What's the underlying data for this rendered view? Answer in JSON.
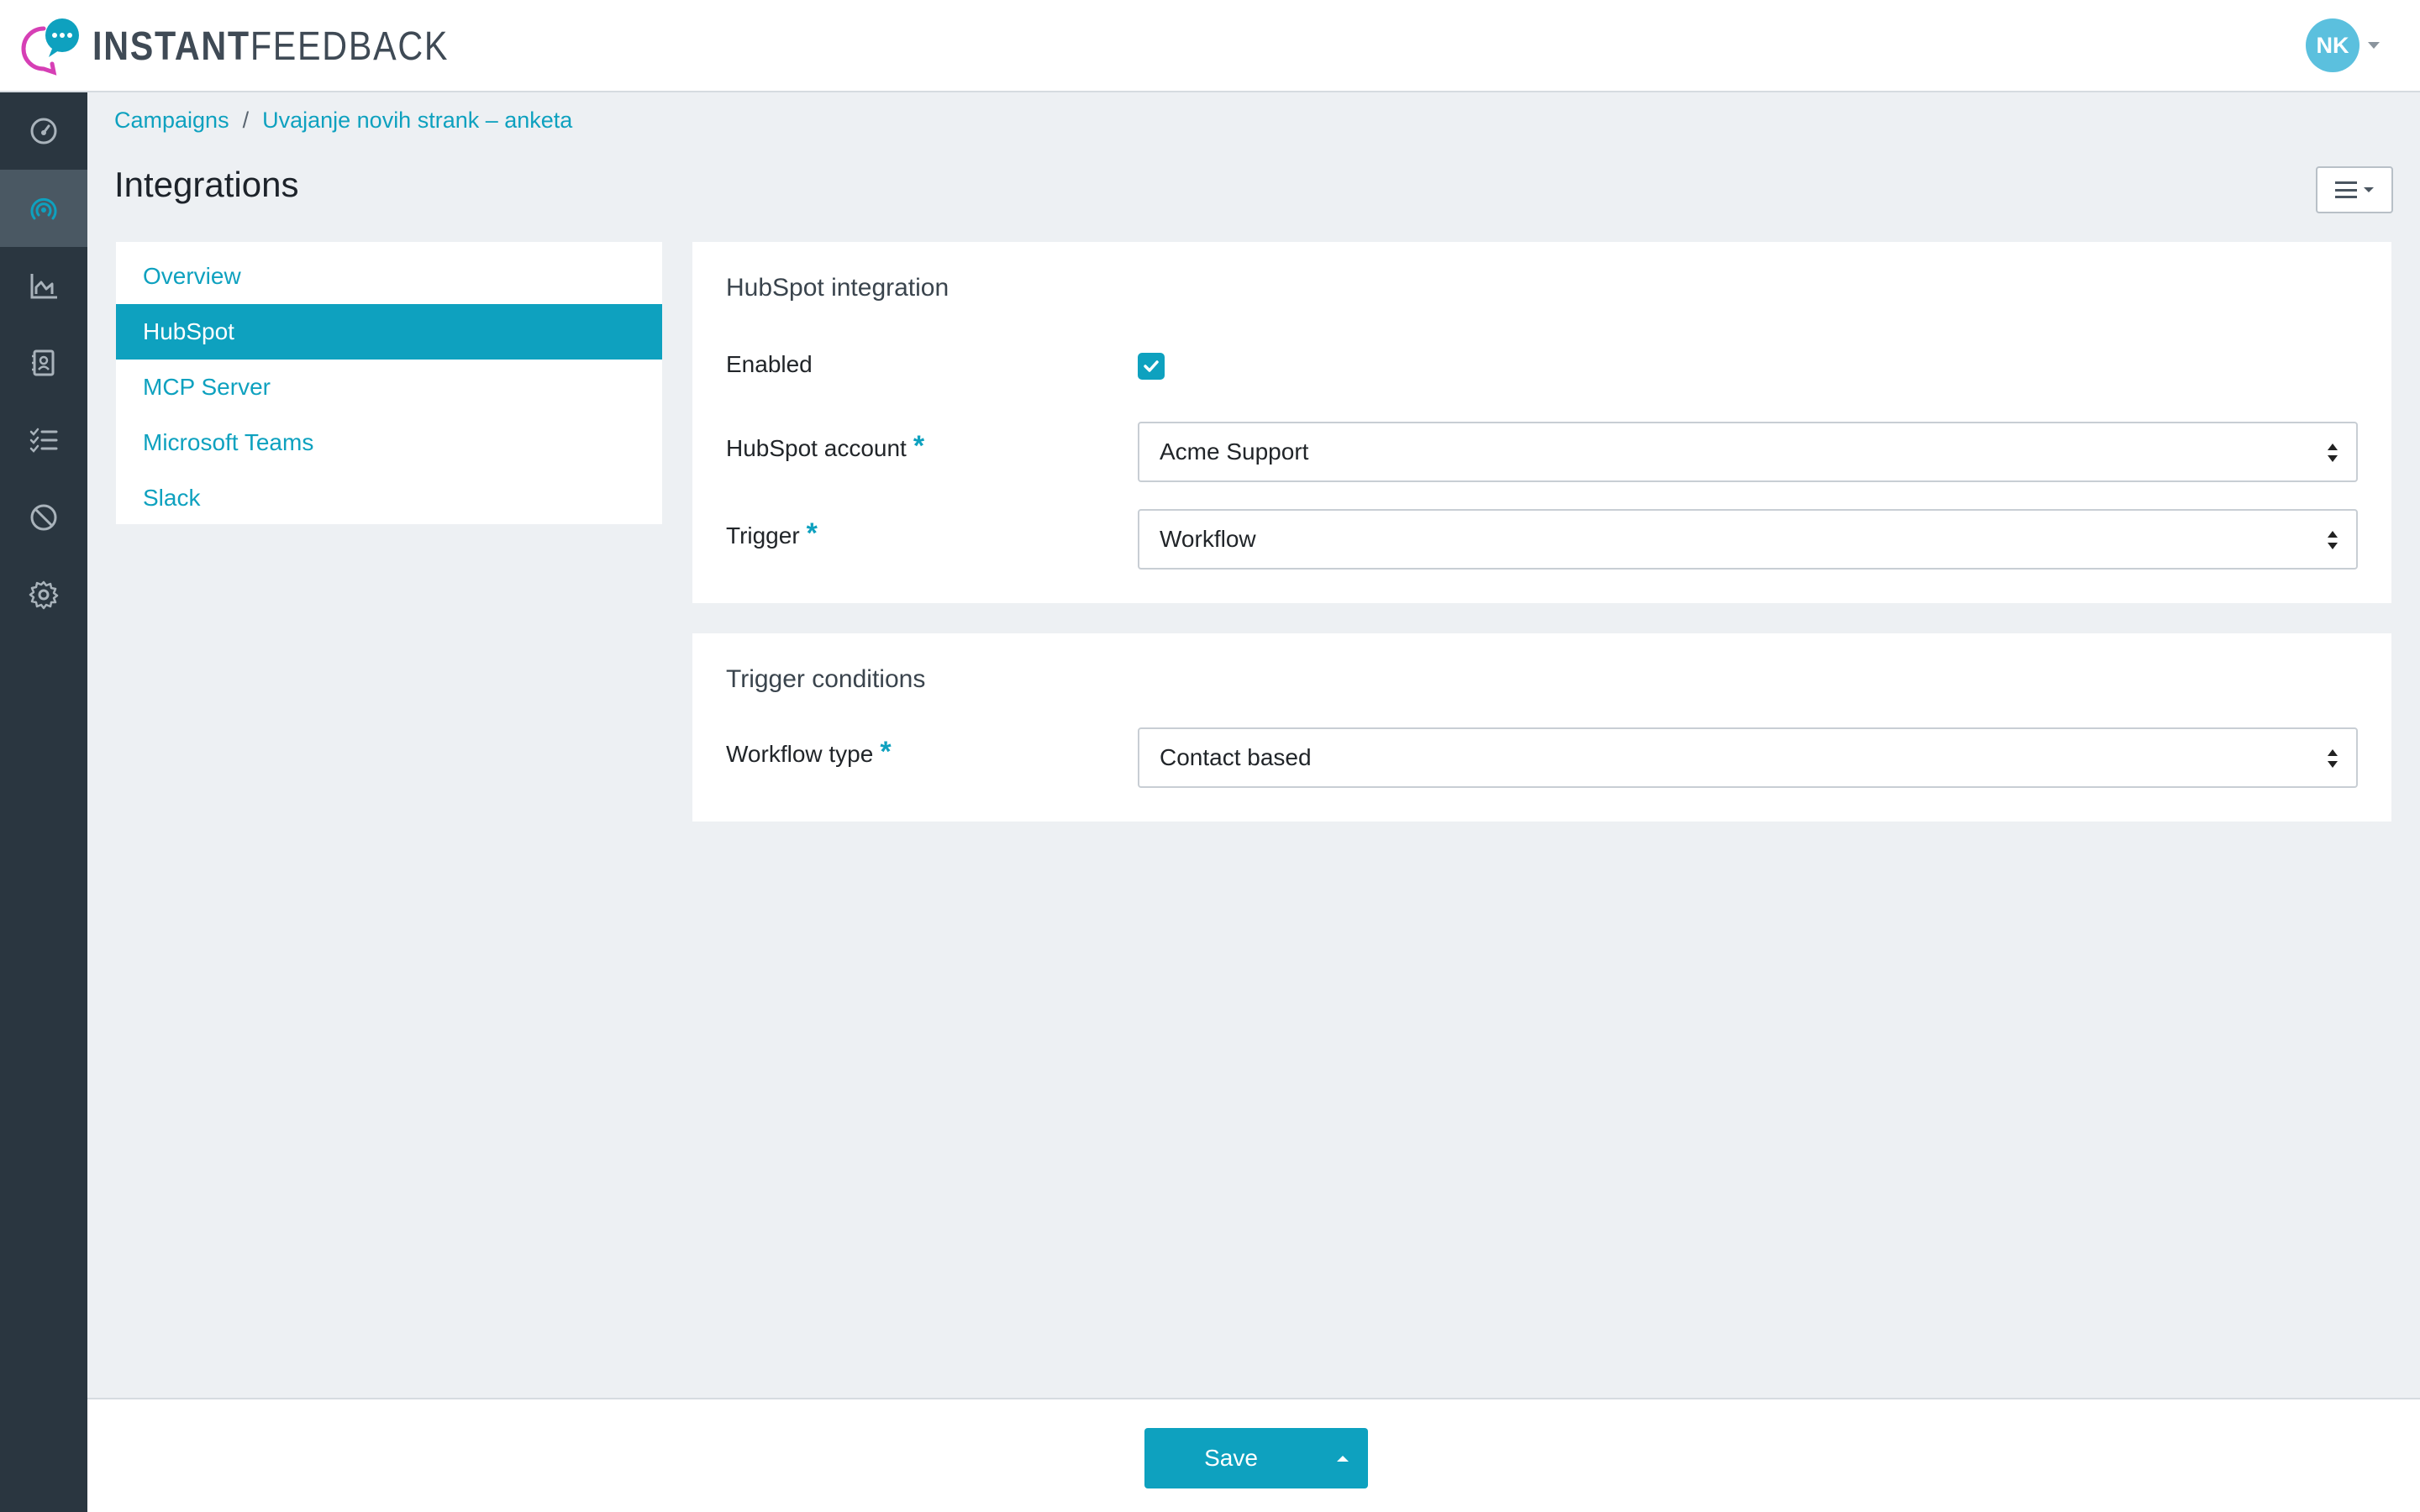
{
  "app": {
    "brand_bold": "INSTANT",
    "brand_light": "FEEDBACK",
    "user_initials": "NK",
    "accent_color": "#0ea1bf"
  },
  "sidebar": {
    "items": [
      {
        "icon": "dashboard-gauge-icon",
        "active": false
      },
      {
        "icon": "broadcast-signal-icon",
        "active": true
      },
      {
        "icon": "chart-area-icon",
        "active": false
      },
      {
        "icon": "contact-book-icon",
        "active": false
      },
      {
        "icon": "checklist-icon",
        "active": false
      },
      {
        "icon": "block-icon",
        "active": false
      },
      {
        "icon": "gear-icon",
        "active": false
      }
    ]
  },
  "breadcrumb": {
    "root": "Campaigns",
    "separator": "/",
    "current": "Uvajanje novih strank – anketa"
  },
  "page": {
    "title": "Integrations"
  },
  "nav": {
    "items": [
      {
        "label": "Overview",
        "active": false
      },
      {
        "label": "HubSpot",
        "active": true
      },
      {
        "label": "MCP Server",
        "active": false
      },
      {
        "label": "Microsoft Teams",
        "active": false
      },
      {
        "label": "Slack",
        "active": false
      }
    ]
  },
  "hubspot": {
    "title": "HubSpot integration",
    "enabled_label": "Enabled",
    "enabled": true,
    "account_label": "HubSpot account",
    "account_value": "Acme Support",
    "trigger_label": "Trigger",
    "trigger_value": "Workflow",
    "required_mark": "*"
  },
  "conditions": {
    "title": "Trigger conditions",
    "workflow_type_label": "Workflow type",
    "workflow_type_value": "Contact based"
  },
  "footer": {
    "save_label": "Save"
  }
}
